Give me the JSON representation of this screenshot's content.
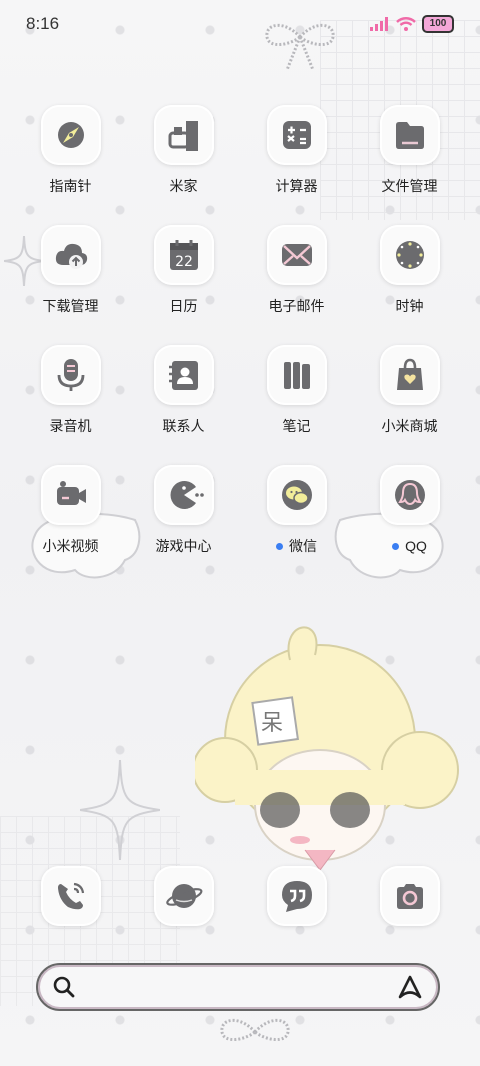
{
  "status": {
    "time": "8:16",
    "battery": "100"
  },
  "apps": [
    {
      "name": "app-compass",
      "icon": "compass-icon",
      "label": "指南针",
      "dot": false
    },
    {
      "name": "app-mijia",
      "icon": "home-icon",
      "label": "米家",
      "dot": false
    },
    {
      "name": "app-calculator",
      "icon": "calculator-icon",
      "label": "计算器",
      "dot": false
    },
    {
      "name": "app-files",
      "icon": "folder-icon",
      "label": "文件管理",
      "dot": false
    },
    {
      "name": "app-downloads",
      "icon": "download-cloud-icon",
      "label": "下载管理",
      "dot": false
    },
    {
      "name": "app-calendar",
      "icon": "calendar-icon",
      "label": "日历",
      "dot": false,
      "icon_text": "22"
    },
    {
      "name": "app-email",
      "icon": "mail-icon",
      "label": "电子邮件",
      "dot": false
    },
    {
      "name": "app-clock",
      "icon": "clock-icon",
      "label": "时钟",
      "dot": false
    },
    {
      "name": "app-recorder",
      "icon": "microphone-icon",
      "label": "录音机",
      "dot": false
    },
    {
      "name": "app-contacts",
      "icon": "contacts-icon",
      "label": "联系人",
      "dot": false
    },
    {
      "name": "app-notes",
      "icon": "notes-icon",
      "label": "笔记",
      "dot": false
    },
    {
      "name": "app-mi-store",
      "icon": "shopping-bag-icon",
      "label": "小米商城",
      "dot": false
    },
    {
      "name": "app-mi-video",
      "icon": "video-camera-icon",
      "label": "小米视频",
      "dot": false
    },
    {
      "name": "app-game-center",
      "icon": "pacman-icon",
      "label": "游戏中心",
      "dot": false
    },
    {
      "name": "app-wechat",
      "icon": "wechat-icon",
      "label": "微信",
      "dot": true
    },
    {
      "name": "app-qq",
      "icon": "qq-penguin-icon",
      "label": "QQ",
      "dot": true
    }
  ],
  "dock": [
    {
      "name": "dock-phone",
      "icon": "phone-icon"
    },
    {
      "name": "dock-browser",
      "icon": "planet-icon"
    },
    {
      "name": "dock-messages",
      "icon": "message-quote-icon"
    },
    {
      "name": "dock-camera",
      "icon": "camera-icon"
    }
  ],
  "search": {
    "left_icon": "search-icon",
    "right_icon": "assistant-a-icon"
  },
  "colors": {
    "icon_fg": "#6b6b6e",
    "accent_pink": "#f4a7d8",
    "notify_dot": "#3a7ef2"
  },
  "wallpaper": {
    "character_sign": "呆"
  }
}
